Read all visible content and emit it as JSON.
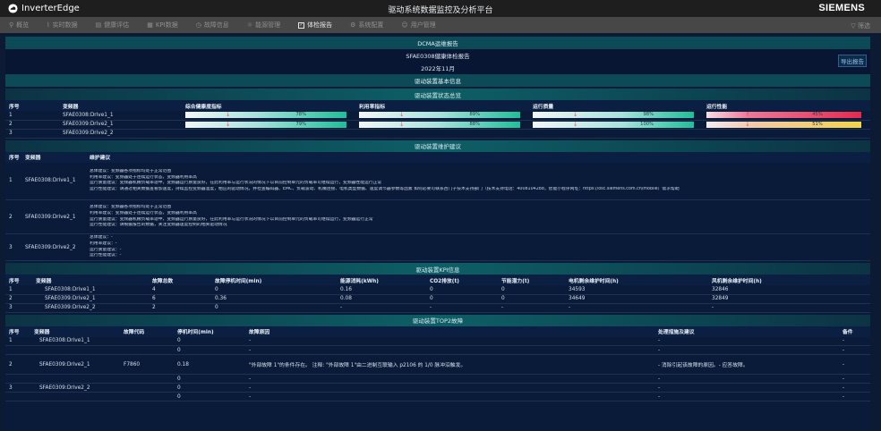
{
  "app": {
    "logo": "InverterEdge",
    "title": "驱动系统数据监控及分析平台",
    "brand": "SIEMENS"
  },
  "nav": [
    {
      "icon": "search-icon",
      "glyph": "⚲",
      "label": "概览"
    },
    {
      "icon": "chart-icon",
      "glyph": "⌇",
      "label": "实时数据"
    },
    {
      "icon": "document-icon",
      "glyph": "▤",
      "label": "健康评估"
    },
    {
      "icon": "kpi-icon",
      "glyph": "▦",
      "label": "KPI数据"
    },
    {
      "icon": "clock-icon",
      "glyph": "◷",
      "label": "故障信息"
    },
    {
      "icon": "bulb-icon",
      "glyph": "☼",
      "label": "能源管理"
    },
    {
      "icon": "report-icon",
      "glyph": "✓",
      "label": "体检报告",
      "active": true
    },
    {
      "icon": "gear-icon",
      "glyph": "⚙",
      "label": "系统配置"
    },
    {
      "icon": "users-icon",
      "glyph": "☺",
      "label": "用户管理"
    }
  ],
  "filter_label": "筛选",
  "report": {
    "head": "DCMA运维报告",
    "subtitle": "SFAE0308健康体检报告",
    "period": "2022年11月",
    "export": "导出报告",
    "basic_info": "驱动装置基本信息"
  },
  "status": {
    "title": "驱动装置状态总览",
    "headers": [
      "序号",
      "变频器",
      "综合健康度指标",
      "利用率指标",
      "运行质量",
      "运行性能"
    ],
    "rows": [
      {
        "no": "1",
        "name": "SFAE0308:Drive1_1",
        "metrics": [
          {
            "v": "78%",
            "f": 0.78,
            "arrow": "↓"
          },
          {
            "v": "89%",
            "f": 0.89,
            "arrow": "↓"
          },
          {
            "v": "98%",
            "f": 0.98,
            "arrow": "↓"
          },
          {
            "v": "45%",
            "f": 0.45,
            "arrow": "↑",
            "kind": "red"
          }
        ]
      },
      {
        "no": "2",
        "name": "SFAE0309:Drive2_1",
        "metrics": [
          {
            "v": "79%",
            "f": 0.79,
            "arrow": "↓"
          },
          {
            "v": "88%",
            "f": 0.88,
            "arrow": "↓"
          },
          {
            "v": "100%",
            "f": 1.0,
            "arrow": "↓"
          },
          {
            "v": "51%",
            "f": 0.51,
            "arrow": "↓",
            "kind": "yellow"
          }
        ]
      },
      {
        "no": "3",
        "name": "SFAE0309:Drive2_2",
        "metrics": []
      }
    ]
  },
  "maint": {
    "title": "驱动装置维护建议",
    "headers": [
      "序号",
      "变频器",
      "维护建议"
    ],
    "rows": [
      {
        "no": "1",
        "name": "SFAE0308:Drive1_1",
        "lines": [
          "总体建议：变频器各项指标均处于正常范围",
          "利用率建议：变频器处于连续运行状态，变频器利用率高",
          "运行质量建议：变频器机械负载率适中，变频器运行质量良好，在此利用率与运行状况的情况下以目前控制单元的负载率可继续运行，变频器性能运行正常",
          "运行性能建议：请通过相关数据查看加速度，持续监控变频器温度，相应的驱动情况，并检查编码器、EMC、负载波动、机械连接、电机类型数据、速度调节器参数等因素 如何必要可联系西门子技术支持部门（技术支持电话：4008104288，智能小程序网址：https://osc.siemens.com.cn/mobile）需求帮助"
        ]
      },
      {
        "no": "2",
        "name": "SFAE0309:Drive2_1",
        "lines": [
          "总体建议：变频器各项指标均处于正常范围",
          "利用率建议：变频器处于连续运行状态，变频器利用率高",
          "运行质量建议：变频器机械负载率适中，变频器运行质量良好，在此利用率与运行状况的情况下以目前控制单元的负载率可继续运行，变频器运行正常",
          "运行性能建议：请根据报告的数据，关注变频器速度控制的相关驱动情况"
        ]
      },
      {
        "no": "3",
        "name": "SFAE0309:Drive2_2",
        "lines": [
          "总体建议：-",
          "利用率建议：-",
          "运行质量建议：-",
          "运行性能建议：-"
        ]
      }
    ]
  },
  "kpi": {
    "title": "驱动装置KPI信息",
    "headers": [
      "序号",
      "变频器",
      "故障总数",
      "故障停机时间(min)",
      "能源消耗(kWh)",
      "CO2排放(t)",
      "节能潜力(t)",
      "电机剩余维护时间(h)",
      "风机剩余维护时间(h)"
    ],
    "rows": [
      [
        "1",
        "SFAE0308:Drive1_1",
        "4",
        "0",
        "0.16",
        "0",
        "0",
        "34593",
        "32846"
      ],
      [
        "2",
        "SFAE0309:Drive2_1",
        "6",
        "0.36",
        "0.08",
        "0",
        "0",
        "34649",
        "32849"
      ],
      [
        "3",
        "SFAE0309:Drive2_2",
        "2",
        "0",
        "-",
        "-",
        "-",
        "-",
        "-"
      ]
    ]
  },
  "top2": {
    "title": "驱动装置TOP2故障",
    "headers": [
      "序号",
      "变频器",
      "故障代码",
      "停机时间(min)",
      "故障原因",
      "处理措施及建议",
      "备件"
    ],
    "rows": [
      [
        "1",
        "SFAE0308:Drive1_1",
        "",
        "0",
        "-",
        "-",
        "-"
      ],
      [
        "",
        "",
        "",
        "0",
        "-",
        "-",
        "-"
      ],
      [
        "2",
        "SFAE0309:Drive2_1",
        "F7860",
        "0.18",
        "\"外部故障 1\"的条件存在。 注释: \"外部故障 1\"由二进制互联输入 p2106 的 1/0 脉冲沿触发。",
        "- 消除引起该故障的原因。- 应答故障。",
        "-"
      ],
      [
        "",
        "",
        "",
        "0",
        "-",
        "-",
        "-"
      ],
      [
        "3",
        "SFAE0309:Drive2_2",
        "",
        "0",
        "-",
        "-",
        "-"
      ],
      [
        "",
        "",
        "",
        "0",
        "-",
        "-",
        "-"
      ]
    ]
  }
}
